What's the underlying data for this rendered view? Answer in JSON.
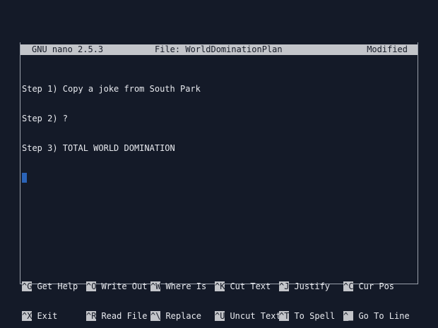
{
  "titlebar": {
    "app": "GNU nano 2.5.3",
    "file": "File: WorldDominationPlan",
    "status": "Modified"
  },
  "editor": {
    "lines": [
      "Step 1) Copy a joke from South Park",
      "Step 2) ?",
      "Step 3) TOTAL WORLD DOMINATION"
    ]
  },
  "shortcuts": {
    "row1": [
      {
        "key": "^G",
        "label": "Get Help"
      },
      {
        "key": "^O",
        "label": "Write Out"
      },
      {
        "key": "^W",
        "label": "Where Is"
      },
      {
        "key": "^K",
        "label": "Cut Text"
      },
      {
        "key": "^J",
        "label": "Justify"
      },
      {
        "key": "^C",
        "label": "Cur Pos"
      }
    ],
    "row2": [
      {
        "key": "^X",
        "label": "Exit"
      },
      {
        "key": "^R",
        "label": "Read File"
      },
      {
        "key": "^\\",
        "label": "Replace"
      },
      {
        "key": "^U",
        "label": "Uncut Text"
      },
      {
        "key": "^T",
        "label": "To Spell"
      },
      {
        "key": "^_",
        "label": "Go To Line"
      }
    ]
  }
}
